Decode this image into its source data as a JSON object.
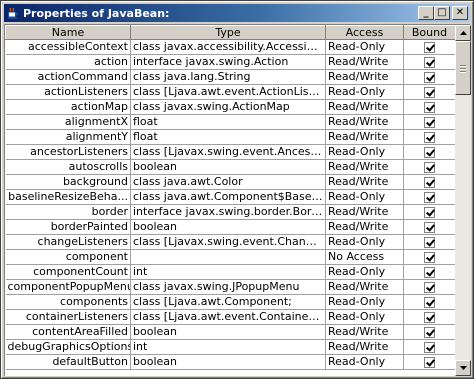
{
  "window": {
    "title": "Properties of JavaBean:",
    "minimize_glyph": "_",
    "maximize_glyph": "□",
    "close_glyph": "✕",
    "icon": "coffee-cup-icon"
  },
  "table": {
    "columns": [
      "Name",
      "Type",
      "Access",
      "Bound"
    ],
    "rows": [
      {
        "name": "accessibleContext",
        "type": "class javax.accessibility.AccessibleC",
        "access": "Read-Only",
        "bound": true
      },
      {
        "name": "action",
        "type": "interface javax.swing.Action",
        "access": "Read/Write",
        "bound": true
      },
      {
        "name": "actionCommand",
        "type": "class java.lang.String",
        "access": "Read/Write",
        "bound": true
      },
      {
        "name": "actionListeners",
        "type": "class [Ljava.awt.event.ActionListener;",
        "access": "Read-Only",
        "bound": true
      },
      {
        "name": "actionMap",
        "type": "class javax.swing.ActionMap",
        "access": "Read/Write",
        "bound": true
      },
      {
        "name": "alignmentX",
        "type": "float",
        "access": "Read/Write",
        "bound": true
      },
      {
        "name": "alignmentY",
        "type": "float",
        "access": "Read/Write",
        "bound": true
      },
      {
        "name": "ancestorListeners",
        "type": "class [Ljavax.swing.event.Ancestor...",
        "access": "Read-Only",
        "bound": true
      },
      {
        "name": "autoscrolls",
        "type": "boolean",
        "access": "Read/Write",
        "bound": true
      },
      {
        "name": "background",
        "type": "class java.awt.Color",
        "access": "Read/Write",
        "bound": true
      },
      {
        "name": "baselineResizeBeha...",
        "type": "class java.awt.Component$Baselin...",
        "access": "Read-Only",
        "bound": true
      },
      {
        "name": "border",
        "type": "interface javax.swing.border.Border",
        "access": "Read/Write",
        "bound": true
      },
      {
        "name": "borderPainted",
        "type": "boolean",
        "access": "Read/Write",
        "bound": true
      },
      {
        "name": "changeListeners",
        "type": "class [Ljavax.swing.event.ChangeL...",
        "access": "Read-Only",
        "bound": true
      },
      {
        "name": "component",
        "type": "",
        "access": "No Access",
        "bound": true
      },
      {
        "name": "componentCount",
        "type": "int",
        "access": "Read-Only",
        "bound": true
      },
      {
        "name": "componentPopupMenu",
        "type": "class javax.swing.JPopupMenu",
        "access": "Read/Write",
        "bound": true
      },
      {
        "name": "components",
        "type": "class [Ljava.awt.Component;",
        "access": "Read-Only",
        "bound": true
      },
      {
        "name": "containerListeners",
        "type": "class [Ljava.awt.event.ContainerLis...",
        "access": "Read-Only",
        "bound": true
      },
      {
        "name": "contentAreaFilled",
        "type": "boolean",
        "access": "Read/Write",
        "bound": true
      },
      {
        "name": "debugGraphicsOptions",
        "type": "int",
        "access": "Read/Write",
        "bound": true
      },
      {
        "name": "defaultButton",
        "type": "boolean",
        "access": "Read-Only",
        "bound": true
      }
    ]
  },
  "colors": {
    "title_gradient_start": "#0a246a",
    "title_gradient_end": "#a6caf0",
    "chrome": "#d4d0c8"
  }
}
